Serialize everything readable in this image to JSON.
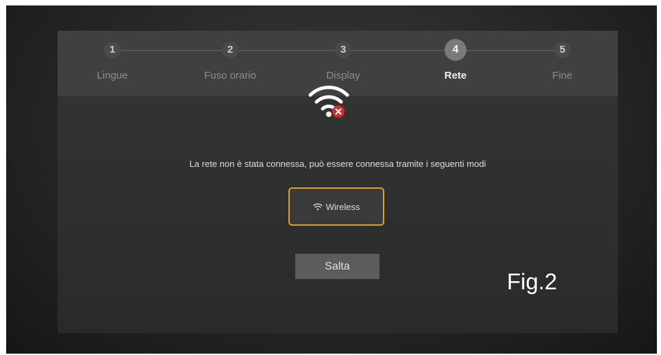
{
  "stepper": {
    "steps": [
      {
        "number": "1",
        "label": "Lingue"
      },
      {
        "number": "2",
        "label": "Fuso orario"
      },
      {
        "number": "3",
        "label": "Display"
      },
      {
        "number": "4",
        "label": "Rete"
      },
      {
        "number": "5",
        "label": "Fine"
      }
    ],
    "active_step": "4"
  },
  "network": {
    "status_icon": "wifi-disconnected-icon",
    "message": "La rete non è stata connessa, può essere connessa tramite i seguenti modi",
    "wireless_label": "Wireless",
    "skip_label": "Salta"
  },
  "caption": "Fig.2",
  "colors": {
    "focus_border": "#e0a226",
    "error_badge": "#d62a2a"
  }
}
